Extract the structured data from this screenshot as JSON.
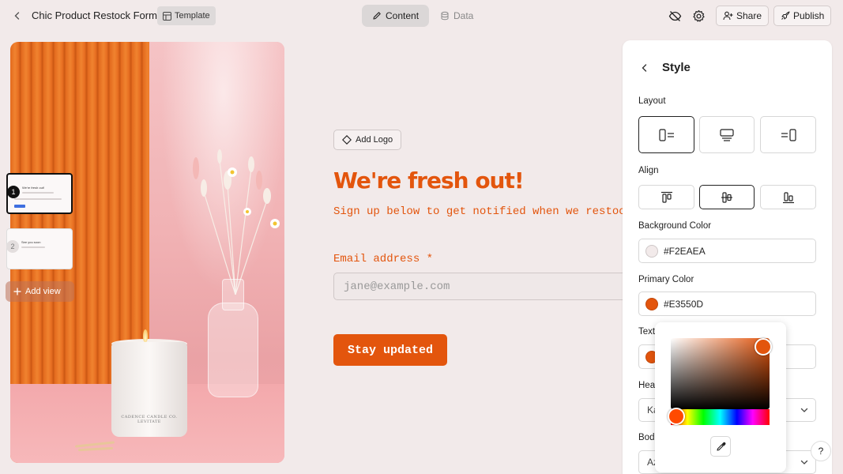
{
  "header": {
    "title": "Chic Product Restock Form",
    "template_badge": "Template",
    "tabs": [
      {
        "label": "Content",
        "icon": "pencil-icon",
        "active": true
      },
      {
        "label": "Data",
        "icon": "database-icon",
        "active": false
      }
    ],
    "share_label": "Share",
    "publish_label": "Publish"
  },
  "views": {
    "thumbs": [
      {
        "number": "1",
        "title": "We're fresh out!"
      },
      {
        "number": "2",
        "title": "See you soon"
      }
    ],
    "add_view_label": "Add view"
  },
  "image": {
    "candle_label": "CADENCE CANDLE CO. LEVITATE"
  },
  "form": {
    "add_logo_label": "Add Logo",
    "headline": "We're fresh out!",
    "subheadline": "Sign up below to get notified when we restock",
    "email_label": "Email address",
    "required_mark": "*",
    "email_placeholder": "jane@example.com",
    "submit_label": "Stay updated"
  },
  "style_panel": {
    "title": "Style",
    "layout_label": "Layout",
    "align_label": "Align",
    "background_color_label": "Background Color",
    "background_color": "#F2EAEA",
    "primary_color_label": "Primary Color",
    "primary_color": "#E3550D",
    "text_color_label": "Text",
    "text_color_value": "#E3550D",
    "heading_font_label": "Hea",
    "heading_font_value": "Ka",
    "body_font_label": "Bod",
    "body_font_value": "Az"
  },
  "help_label": "?"
}
